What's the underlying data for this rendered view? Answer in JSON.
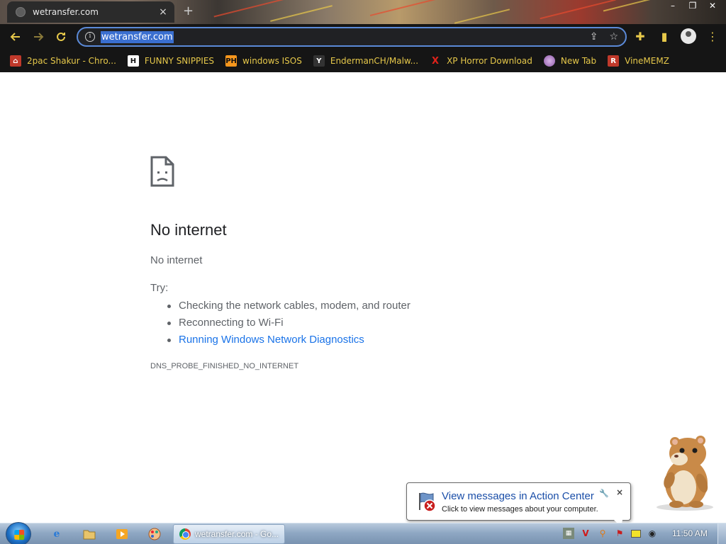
{
  "browser": {
    "tab": {
      "title": "wetransfer.com",
      "close_glyph": "×"
    },
    "new_tab_glyph": "+",
    "omnibox": {
      "url": "wetransfer.com"
    },
    "bookmarks": [
      {
        "label": "2pac Shakur - Chro...",
        "icon": "red-house-icon",
        "icon_text": "",
        "color": "#c0392b"
      },
      {
        "label": "FUNNY SNIPPIES",
        "icon": "h-logo-icon",
        "icon_text": "H",
        "color": "#ffffff"
      },
      {
        "label": "windows ISOS",
        "icon": "ph-logo-icon",
        "icon_text": "PH",
        "color": "#f7971d"
      },
      {
        "label": "EndermanCH/Malw...",
        "icon": "yt-logo-icon",
        "icon_text": "Y",
        "color": "#333333"
      },
      {
        "label": "XP Horror Download",
        "icon": "x-icon",
        "icon_text": "X",
        "color": "#e0221b"
      },
      {
        "label": "New Tab",
        "icon": "globe-icon",
        "icon_text": "",
        "color": "#9b59b6"
      },
      {
        "label": "VineMEMZ",
        "icon": "r-logo-icon",
        "icon_text": "R",
        "color": "#c0392b"
      }
    ]
  },
  "error_page": {
    "title": "No internet",
    "subtitle": "No internet",
    "try_label": "Try:",
    "suggestions": [
      "Checking the network cables, modem, and router",
      "Reconnecting to Wi-Fi",
      "Running Windows Network Diagnostics"
    ],
    "error_code": "DNS_PROBE_FINISHED_NO_INTERNET"
  },
  "notification": {
    "title": "View messages in Action Center",
    "message": "Click to view messages about your computer.",
    "close_glyph": "×"
  },
  "taskbar": {
    "active_window_label": "wetransfer.com - Go...",
    "clock": "11:50 AM"
  },
  "colors": {
    "toolbar_accent": "#e6c84a",
    "omnibox_focus": "#5b8ad8",
    "link_blue": "#1a73e8"
  }
}
